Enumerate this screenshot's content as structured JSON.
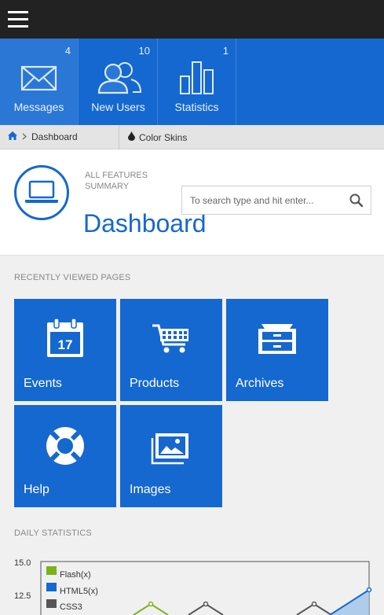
{
  "topbar": {
    "menu_icon": "hamburger-icon"
  },
  "stats": [
    {
      "label": "Messages",
      "count": "4",
      "icon": "envelope-icon"
    },
    {
      "label": "New Users",
      "count": "10",
      "icon": "users-icon"
    },
    {
      "label": "Statistics",
      "count": "1",
      "icon": "bar-chart-icon"
    }
  ],
  "breadcrumb": {
    "home_icon": "home-icon",
    "current": "Dashboard",
    "skins_label": "Color Skins",
    "skins_icon": "drop-icon"
  },
  "header": {
    "features_line1": "ALL FEATURES",
    "features_line2": "SUMMARY",
    "title": "Dashboard",
    "search_placeholder": "To search type and hit enter...",
    "page_icon": "laptop-icon"
  },
  "recent": {
    "heading": "RECENTLY VIEWED PAGES",
    "tiles": [
      {
        "label": "Events",
        "icon": "calendar-icon",
        "date": "17"
      },
      {
        "label": "Products",
        "icon": "shopping-cart-icon"
      },
      {
        "label": "Archives",
        "icon": "archive-icon"
      },
      {
        "label": "Help",
        "icon": "lifebuoy-icon"
      },
      {
        "label": "Images",
        "icon": "images-icon"
      }
    ]
  },
  "daily": {
    "heading": "DAILY STATISTICS",
    "colors": {
      "flash": "#7ab317",
      "html5": "#1568cf",
      "css3": "#555555"
    }
  },
  "chart_data": {
    "type": "line",
    "y_ticks": [
      "15.0",
      "12.5"
    ],
    "series": [
      {
        "name": "Flash(x)",
        "color": "#7ab317"
      },
      {
        "name": "HTML5(x)",
        "color": "#1568cf"
      },
      {
        "name": "CSS3",
        "color": "#555555"
      }
    ]
  }
}
